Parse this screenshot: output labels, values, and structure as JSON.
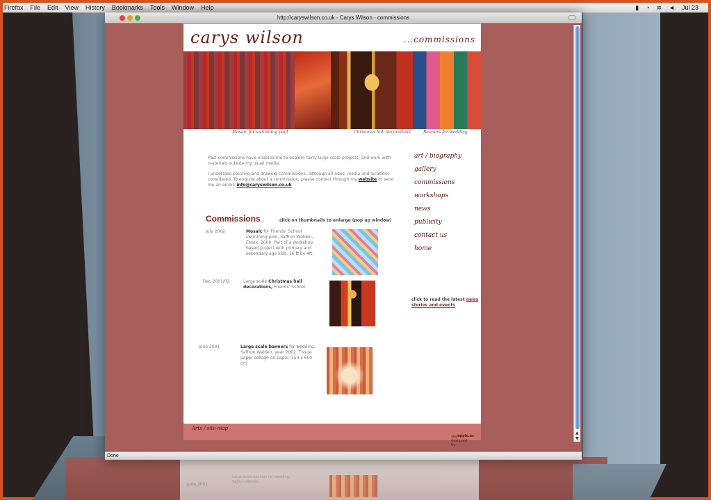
{
  "menubar": {
    "items": [
      "Firefox",
      "File",
      "Edit",
      "View",
      "History",
      "Bookmarks",
      "Tools",
      "Window",
      "Help"
    ],
    "clock": "Jul 23"
  },
  "window": {
    "title": "http://caryswilson.co.uk - Carys Wilson - commissions",
    "status": "Done"
  },
  "site": {
    "logo": "carys wilson",
    "section": "...commissions",
    "captions": [
      "Mosaic for swimming pool",
      "Christmas hall decorations",
      "Banners for wedding"
    ],
    "intro": {
      "p1": "Past commissions have enabled me to explore fairly large scale projects, and work with materials outside my usual media.",
      "p2a": "I undertake painting and drawing commissions, although all sizes, media and locations considered. To enquire about a commission, please contact through my",
      "p2_link": "website",
      "p2b": "or send me an email:",
      "email": "info@caryswilson.co.uk"
    },
    "nav": [
      "art / biography",
      "gallery",
      "commissions",
      "workshops",
      "news",
      "publicity",
      "contact us",
      "home"
    ],
    "news_note": {
      "text": "click to read the latest",
      "link": "news stories and events"
    },
    "commissions_title": "Commissions",
    "commissions_hint": "click on thumbnails to enlarge (pop up window)",
    "rows": [
      {
        "date": "July 2002",
        "bold": "Mosaic",
        "text": "for Friends' School swimming pool, Saffron Walden, Essex, 2000. Part of a workshop based project with primary and secondary age kids. 16 ft by 4ft."
      },
      {
        "date": "Dec 2001/02",
        "pre": "Large scale",
        "bold": "Christmas hall decorations,",
        "text": "Friends' School."
      },
      {
        "date": "June 2001",
        "bold": "Large scale banners",
        "text": "for wedding, Saffron Walden, year 2002. Tissue paper collage on paper. 150 x 600 cm"
      }
    ],
    "footer_link": "Arts / site map",
    "footer_credit": "site designed by",
    "footer_credit_name": "apple.ac"
  },
  "reflection": {
    "date": "June 2001",
    "text": "Large scale banners for wedding, Saffron Walden"
  }
}
